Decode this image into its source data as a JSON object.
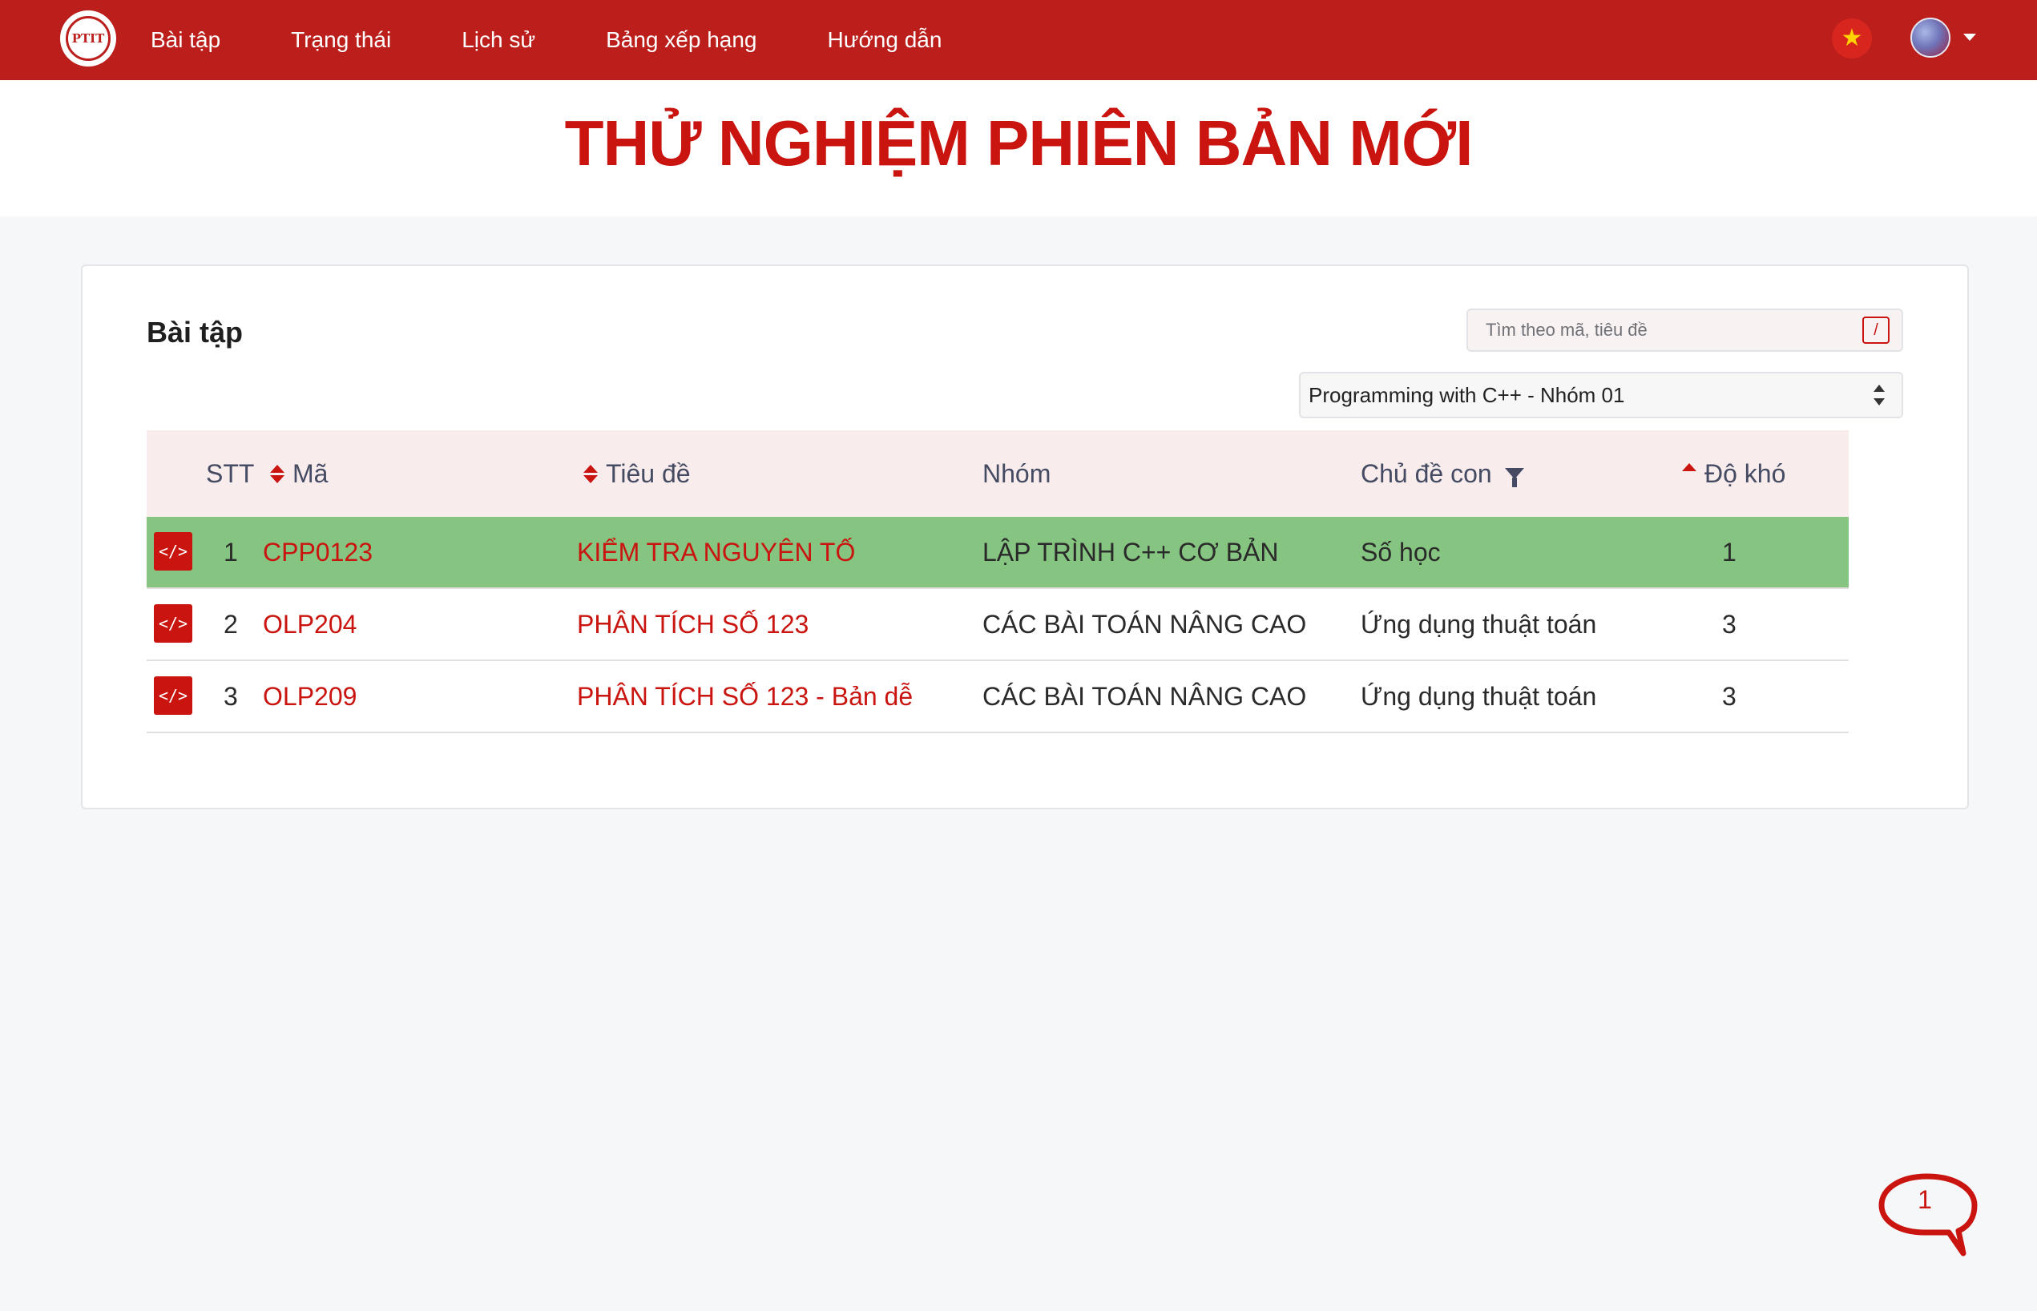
{
  "navbar": {
    "logo_text": "PTIT",
    "items": [
      {
        "label": "Bài tập"
      },
      {
        "label": "Trạng thái"
      },
      {
        "label": "Lịch sử"
      },
      {
        "label": "Bảng xếp hạng"
      },
      {
        "label": "Hướng dẫn"
      }
    ],
    "flag_icon": "★"
  },
  "banner": {
    "title": "THỬ NGHIỆM PHIÊN BẢN MỚI"
  },
  "card": {
    "title": "Bài tập",
    "search": {
      "placeholder": "Tìm theo mã, tiêu đề",
      "shortcut": "/"
    },
    "group_select": {
      "value": "Programming with C++ - Nhóm 01"
    }
  },
  "table": {
    "headers": {
      "stt": "STT",
      "code": "Mã",
      "title": "Tiêu đề",
      "group": "Nhóm",
      "subtopic": "Chủ đề con",
      "difficulty": "Độ khó"
    },
    "rows": [
      {
        "icon": "</>",
        "stt": "1",
        "code": "CPP0123",
        "title": "KIỂM TRA NGUYÊN TỐ",
        "group": "LẬP TRÌNH C++ CƠ BẢN",
        "subtopic": "Số học",
        "difficulty": "1"
      },
      {
        "icon": "</>",
        "stt": "2",
        "code": "OLP204",
        "title": "PHÂN TÍCH SỐ 123",
        "group": "CÁC BÀI TOÁN NÂNG CAO",
        "subtopic": "Ứng dụng thuật toán",
        "difficulty": "3"
      },
      {
        "icon": "</>",
        "stt": "3",
        "code": "OLP209",
        "title": "PHÂN TÍCH SỐ 123 - Bản dễ",
        "group": "CÁC BÀI TOÁN NÂNG CAO",
        "subtopic": "Ứng dụng thuật toán",
        "difficulty": "3"
      }
    ]
  },
  "chat": {
    "count": "1"
  },
  "colors": {
    "brand": "#bb1e1b",
    "accent": "#c9140f",
    "solved_row": "#86c581"
  }
}
